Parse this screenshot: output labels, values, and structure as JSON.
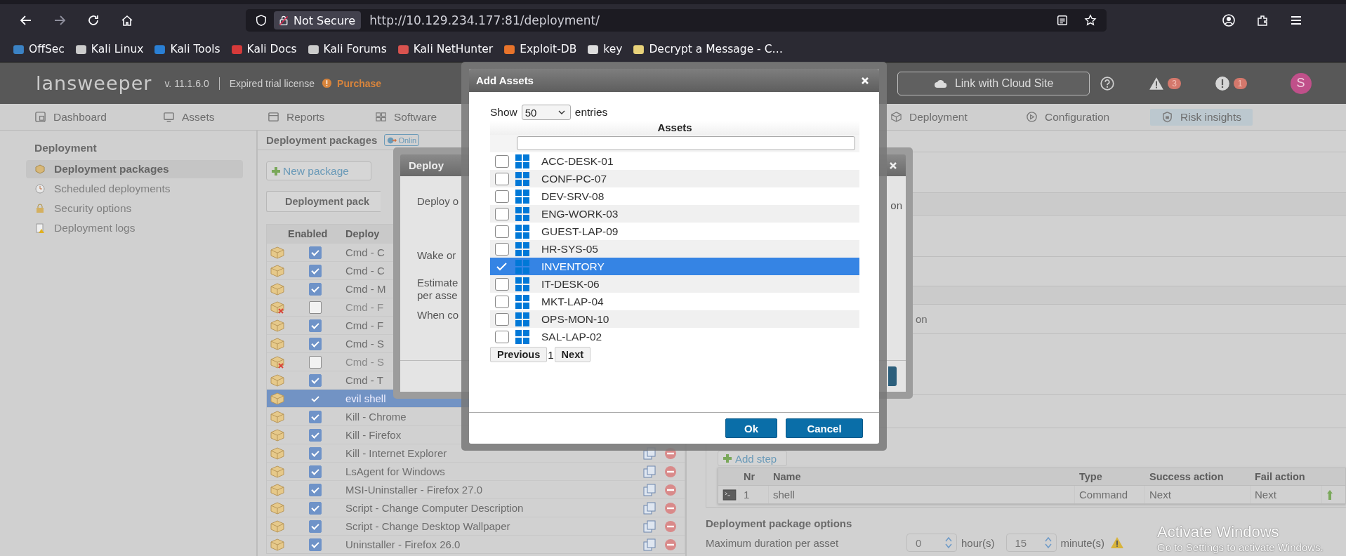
{
  "browser": {
    "security": "Not Secure",
    "url": "http://10.129.234.177:81/deployment/"
  },
  "bookmarks": [
    {
      "label": "OffSec"
    },
    {
      "label": "Kali Linux"
    },
    {
      "label": "Kali Tools"
    },
    {
      "label": "Kali Docs"
    },
    {
      "label": "Kali Forums"
    },
    {
      "label": "Kali NetHunter"
    },
    {
      "label": "Exploit-DB"
    },
    {
      "label": "key"
    },
    {
      "label": "Decrypt a Message - C…"
    }
  ],
  "app_header": {
    "logo": "lansweeper",
    "version": "v. 11.1.6.0",
    "license": "Expired trial license",
    "purchase": "Purchase",
    "cloud_button": "Link with Cloud Site",
    "warnings": "3",
    "errors": "1",
    "avatar": "S"
  },
  "nav": [
    {
      "label": "Dashboard",
      "selected": false
    },
    {
      "label": "Assets",
      "selected": false
    },
    {
      "label": "Reports",
      "selected": false
    },
    {
      "label": "Software",
      "selected": false
    },
    {
      "label": "Deployment",
      "selected": false
    },
    {
      "label": "Configuration",
      "selected": false
    },
    {
      "label": "Risk insights",
      "selected": true
    }
  ],
  "sidebar": {
    "title": "Deployment",
    "items": [
      {
        "label": "Deployment packages",
        "selected": true
      },
      {
        "label": "Scheduled deployments",
        "selected": false
      },
      {
        "label": "Security options",
        "selected": false
      },
      {
        "label": "Deployment logs",
        "selected": false
      }
    ]
  },
  "packages": {
    "title": "Deployment packages",
    "badge": "Onlin",
    "new_button": "New package",
    "tab_button": "Deployment pack",
    "columns": [
      "Enabled",
      "Deploy"
    ],
    "rows": [
      {
        "name": "Cmd - C",
        "enabled": true,
        "selected": false,
        "actions": false
      },
      {
        "name": "Cmd - C",
        "enabled": true,
        "selected": false,
        "actions": false
      },
      {
        "name": "Cmd - M",
        "enabled": true,
        "selected": false,
        "actions": false
      },
      {
        "name": "Cmd - F",
        "enabled": false,
        "selected": false,
        "actions": false
      },
      {
        "name": "Cmd - F",
        "enabled": true,
        "selected": false,
        "actions": false
      },
      {
        "name": "Cmd - S",
        "enabled": true,
        "selected": false,
        "actions": false
      },
      {
        "name": "Cmd - S",
        "enabled": false,
        "selected": false,
        "actions": false
      },
      {
        "name": "Cmd - T",
        "enabled": true,
        "selected": false,
        "actions": false
      },
      {
        "name": "evil shell",
        "enabled": true,
        "selected": true,
        "actions": false
      },
      {
        "name": "Kill - Chrome",
        "enabled": true,
        "selected": false,
        "actions": false
      },
      {
        "name": "Kill - Firefox",
        "enabled": true,
        "selected": false,
        "actions": false
      },
      {
        "name": "Kill - Internet Explorer",
        "enabled": true,
        "selected": false,
        "actions": true
      },
      {
        "name": "LsAgent for Windows",
        "enabled": true,
        "selected": false,
        "actions": true
      },
      {
        "name": "MSI-Uninstaller - Firefox 27.0",
        "enabled": true,
        "selected": false,
        "actions": true
      },
      {
        "name": "Script - Change Computer Description",
        "enabled": true,
        "selected": false,
        "actions": true
      },
      {
        "name": "Script - Change Desktop Wallpaper",
        "enabled": true,
        "selected": false,
        "actions": true
      },
      {
        "name": "Uninstaller - Firefox 26.0",
        "enabled": true,
        "selected": false,
        "actions": true
      }
    ]
  },
  "deploy_dialog": {
    "title": "Deploy",
    "labels": [
      "Deploy o",
      "Wake or",
      "Estimate per asse",
      "When co"
    ],
    "fragment": "on"
  },
  "add_assets": {
    "title": "Add Assets",
    "show_label": "Show",
    "page_size": "50",
    "entries_label": "entries",
    "column": "Assets",
    "rows": [
      {
        "name": "ACC-DESK-01",
        "checked": false,
        "selected": false
      },
      {
        "name": "CONF-PC-07",
        "checked": false,
        "selected": false
      },
      {
        "name": "DEV-SRV-08",
        "checked": false,
        "selected": false
      },
      {
        "name": "ENG-WORK-03",
        "checked": false,
        "selected": false
      },
      {
        "name": "GUEST-LAP-09",
        "checked": false,
        "selected": false
      },
      {
        "name": "HR-SYS-05",
        "checked": false,
        "selected": false
      },
      {
        "name": "INVENTORY",
        "checked": true,
        "selected": true
      },
      {
        "name": "IT-DESK-06",
        "checked": false,
        "selected": false
      },
      {
        "name": "MKT-LAP-04",
        "checked": false,
        "selected": false
      },
      {
        "name": "OPS-MON-10",
        "checked": false,
        "selected": false
      },
      {
        "name": "SAL-LAP-02",
        "checked": false,
        "selected": false
      }
    ],
    "previous": "Previous",
    "page": "1",
    "next": "Next",
    "ok": "Ok",
    "cancel": "Cancel"
  },
  "right_panel": {
    "fragment": "on",
    "add_step": "Add step",
    "steps": {
      "columns": [
        "Nr",
        "Name",
        "Type",
        "Success action",
        "Fail action"
      ],
      "rows": [
        {
          "nr": "1",
          "name": "shell",
          "type": "Command",
          "success": "Next",
          "fail": "Next"
        }
      ]
    },
    "options_title": "Deployment package options",
    "max_duration_label": "Maximum duration per asset",
    "hours": "0",
    "hours_unit": "hour(s)",
    "minutes": "15",
    "minutes_unit": "minute(s)"
  },
  "watermark": {
    "title": "Activate Windows",
    "subtitle": "Go to Settings to activate Windows."
  }
}
